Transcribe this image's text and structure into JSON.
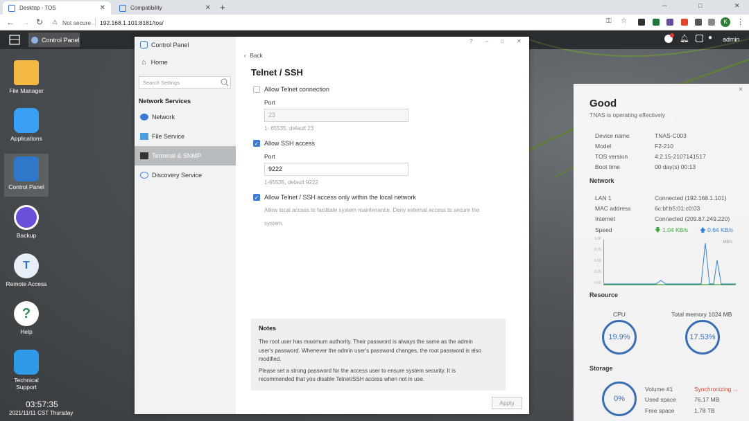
{
  "browser": {
    "tabs": [
      {
        "title": "Desktop - TOS",
        "close": "✕"
      },
      {
        "title": "Compatibility",
        "close": "✕"
      }
    ],
    "new_tab": "+",
    "security": "Not secure",
    "url": "192.168.1.101:8181/tos/",
    "profile_initial": "K",
    "window_controls": [
      "─",
      "□",
      "✕"
    ]
  },
  "taskbar": {
    "app_label": "Control Panel",
    "user": "admin"
  },
  "desktop": {
    "icons": [
      {
        "label": "File Manager",
        "icon": "folder-icon"
      },
      {
        "label": "Applications",
        "icon": "bag-icon"
      },
      {
        "label": "Control Panel",
        "icon": "gear-icon"
      },
      {
        "label": "Backup",
        "icon": "clock-icon"
      },
      {
        "label": "Remote Access",
        "icon": "cloud-icon"
      },
      {
        "label": "Help",
        "icon": "help-icon"
      },
      {
        "label": "Technical Support",
        "icon": "headset-icon"
      }
    ],
    "clock": "03:57:35",
    "date": "2021/11/11 CST Thursday"
  },
  "control_panel": {
    "title": "Control Panel",
    "window_buttons": [
      "?",
      "–",
      "□",
      "✕"
    ],
    "home": "Home",
    "search_placeholder": "Search Settings",
    "section": "Network Services",
    "nav": [
      {
        "label": "Network",
        "active": false
      },
      {
        "label": "File Service",
        "active": false
      },
      {
        "label": "Terminal & SNMP",
        "active": true
      },
      {
        "label": "Discovery Service",
        "active": false
      }
    ],
    "back": "Back",
    "page_title": "Telnet / SSH",
    "telnet": {
      "label": "Allow Telnet connection",
      "checked": false,
      "port_label": "Port",
      "port_value": "23",
      "hint": "1- 65535, default 23"
    },
    "ssh": {
      "label": "Allow SSH access",
      "checked": true,
      "port_label": "Port",
      "port_value": "9222",
      "hint": "1-65535, default 9222"
    },
    "local": {
      "label": "Allow Telnet / SSH access only within the local network",
      "checked": true,
      "desc1": "Allow local access to facilitate system maintenance. Deny external access to secure the",
      "desc2": "system."
    },
    "notes": {
      "title": "Notes",
      "p1": [
        "The root user has maximum authority. Their password is always the same as the admin",
        "user's password. Whenever the admin user's password changes, the root password is also",
        "modified."
      ],
      "p2": [
        "Please set a strong password for the access user to ensure system security. It is",
        "recommended that you disable Telnet/SSH access when not in use."
      ]
    },
    "apply": "Apply"
  },
  "status_panel": {
    "status": "Good",
    "subtitle": "TNAS is operating effectively",
    "device": [
      {
        "k": "Device name",
        "v": "TNAS-C003"
      },
      {
        "k": "Model",
        "v": "F2-210"
      },
      {
        "k": "TOS version",
        "v": "4.2.15-2107141517"
      },
      {
        "k": "Boot time",
        "v": "00 day(s) 00:13"
      }
    ],
    "network_title": "Network",
    "network": [
      {
        "k": "LAN 1",
        "v": "Connected (192.168.1.101)"
      },
      {
        "k": "MAC address",
        "v": "6c:bf:b5:01:c0:03"
      },
      {
        "k": "Internet",
        "v": "Connected (209.87.249.220)"
      }
    ],
    "speed_label": "Speed",
    "down": "1.04 KB/s",
    "up": "0.64 KB/s",
    "chart_unit": "MB/s",
    "chart_ticks": [
      "1.00",
      "0.75",
      "0.50",
      "0.25",
      "0.00"
    ],
    "resource_title": "Resource",
    "cpu_label": "CPU",
    "cpu_value": "19.9%",
    "mem_label": "Total memory 1024 MB",
    "mem_value": "17.53%",
    "storage_title": "Storage",
    "storage_value": "0%",
    "volume": {
      "name": "Volume #1",
      "state": "Synchronizing ...",
      "used_label": "Used space",
      "used": "76.17 MB",
      "free_label": "Free space",
      "free": "1.78 TB"
    },
    "close": "×",
    "colors": {
      "down": "#3aa83a",
      "up": "#2f7fd6",
      "sync": "#d9412b",
      "ring": "#3a6db5"
    }
  }
}
